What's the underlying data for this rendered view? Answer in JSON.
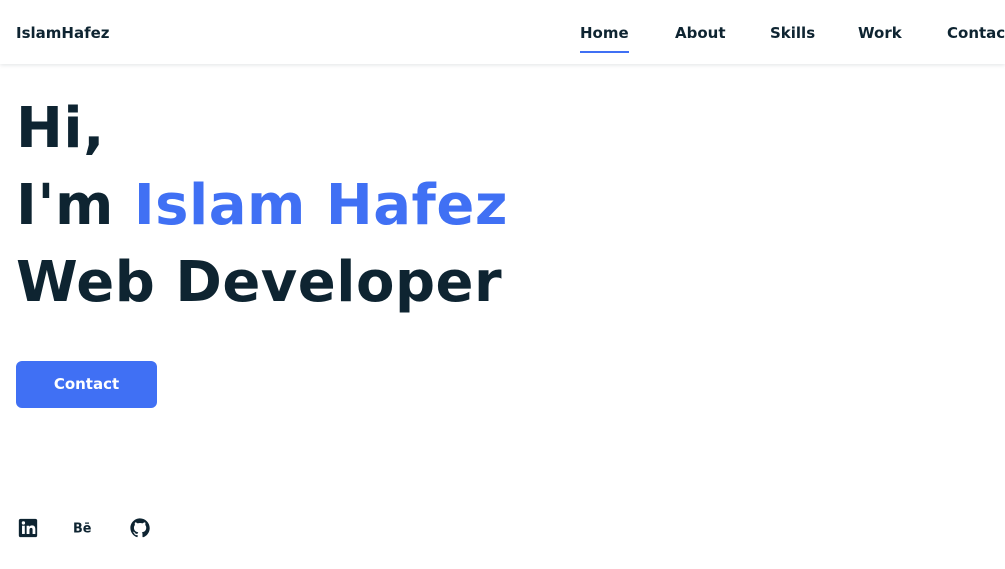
{
  "header": {
    "logo": "IslamHafez",
    "nav": [
      {
        "label": "Home",
        "active": true
      },
      {
        "label": "About",
        "active": false
      },
      {
        "label": "Skills",
        "active": false
      },
      {
        "label": "Work",
        "active": false
      },
      {
        "label": "Contact",
        "active": false
      }
    ]
  },
  "hero": {
    "greeting": "Hi,",
    "intro_prefix": "I'm ",
    "name": "Islam Hafez",
    "role": "Web Developer",
    "cta_label": "Contact"
  },
  "social": [
    {
      "icon": "linkedin-icon"
    },
    {
      "icon": "behance-icon"
    },
    {
      "icon": "github-icon"
    }
  ],
  "colors": {
    "accent": "#4070f4",
    "text": "#0e2431",
    "background": "#ffffff"
  }
}
